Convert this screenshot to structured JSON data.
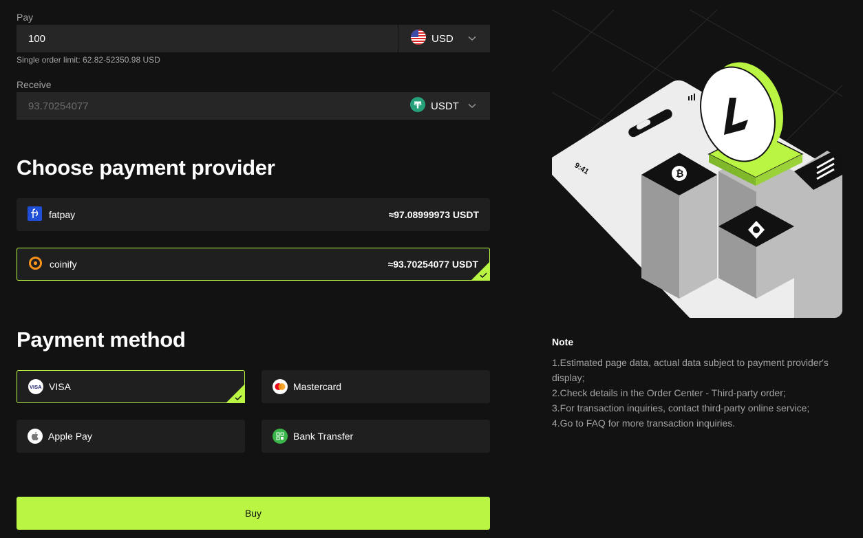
{
  "pay": {
    "label": "Pay",
    "amount": "100",
    "currency": "USD",
    "currency_icon": "us-flag-icon",
    "limit_text": "Single order limit: 62.82-52350.98 USD"
  },
  "receive": {
    "label": "Receive",
    "amount": "93.70254077",
    "currency": "USDT",
    "currency_icon": "tether-icon"
  },
  "providers": {
    "heading": "Choose payment provider",
    "items": [
      {
        "name": "fatpay",
        "amount": "≈97.08999973 USDT",
        "icon": "fatpay-logo-icon",
        "selected": false
      },
      {
        "name": "coinify",
        "amount": "≈93.70254077 USDT",
        "icon": "coinify-logo-icon",
        "selected": true
      }
    ]
  },
  "methods": {
    "heading": "Payment method",
    "items": [
      {
        "name": "VISA",
        "icon": "visa-icon",
        "selected": true
      },
      {
        "name": "Mastercard",
        "icon": "mastercard-icon",
        "selected": false
      },
      {
        "name": "Apple Pay",
        "icon": "apple-icon",
        "selected": false
      },
      {
        "name": "Bank Transfer",
        "icon": "bank-icon",
        "selected": false
      }
    ]
  },
  "buy_label": "Buy",
  "illustration": {
    "phone_time": "9:41"
  },
  "note": {
    "title": "Note",
    "lines": [
      "1.Estimated page data, actual data subject to payment provider's display;",
      "2.Check details in the Order Center - Third-party order;",
      "3.For transaction inquiries, contact third-party online service;",
      "4.Go to FAQ for more transaction inquiries."
    ]
  },
  "colors": {
    "accent": "#b9f542",
    "background": "#121212",
    "field": "#262626",
    "card": "#1f1f1f"
  }
}
